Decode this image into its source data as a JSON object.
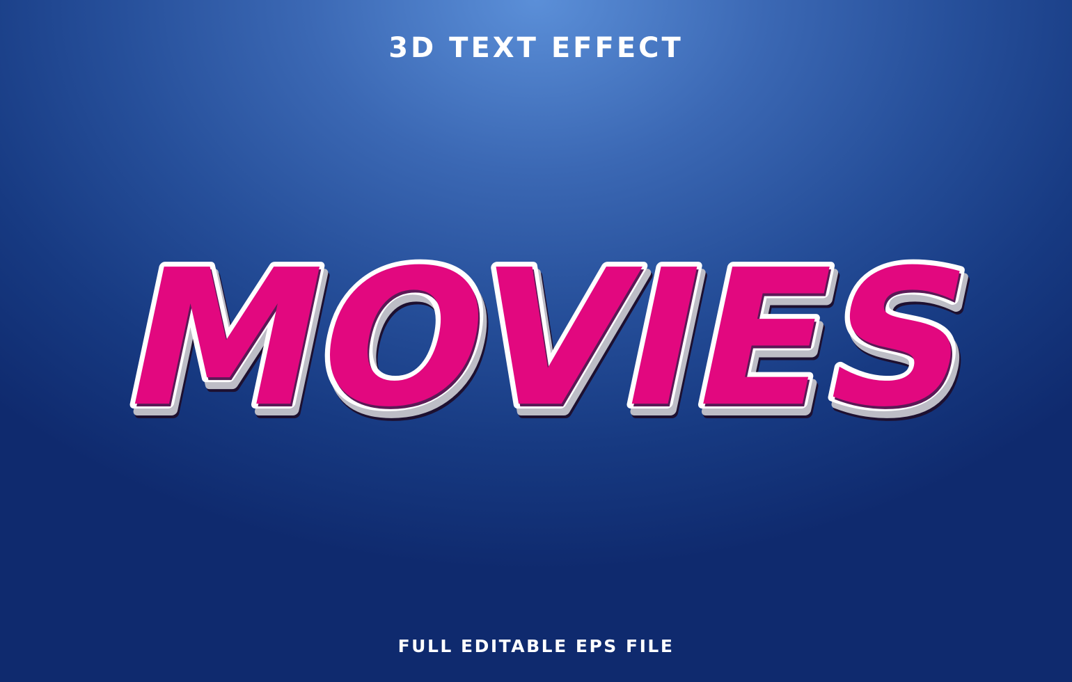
{
  "header": {
    "title": "3D TEXT EFFECT"
  },
  "main": {
    "headline": "MOVIES"
  },
  "footer": {
    "caption": "FULL EDITABLE EPS FILE"
  },
  "colors": {
    "background_light": "#5b8fd8",
    "background_dark": "#0f2a6e",
    "headline_fill": "#e2087f",
    "headline_outline": "#ffffff",
    "headline_extrude": "#5a1a56",
    "caption_text": "#ffffff"
  }
}
